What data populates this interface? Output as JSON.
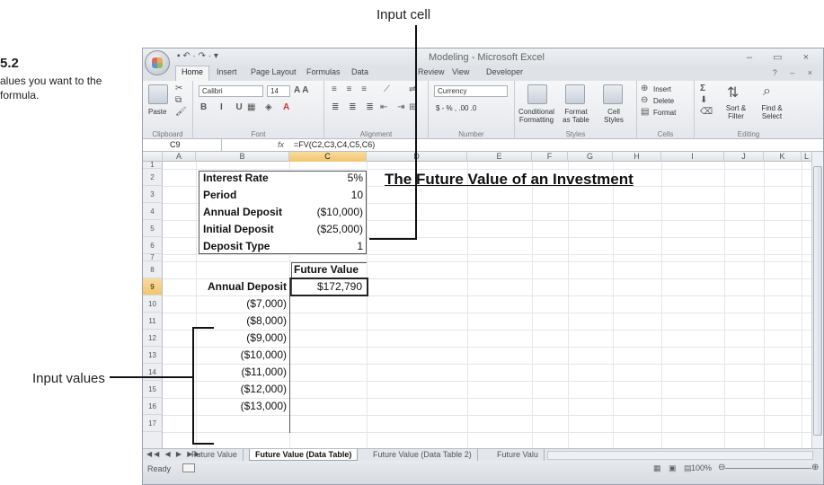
{
  "figure": {
    "number": "5.2",
    "caption": "alues you want to the formula.",
    "callout_input_cell": "Input cell",
    "callout_input_values": "Input values"
  },
  "window": {
    "title": "Modeling - Microsoft Excel",
    "qat": "▪ ↶ · ↷ · ▾",
    "controls": "– ▭ ×"
  },
  "ribbon": {
    "tabs": [
      "Home",
      "Insert",
      "Page Layout",
      "Formulas",
      "Data",
      "Review",
      "View",
      "Developer"
    ],
    "groups": {
      "clipboard": "Clipboard",
      "font": "Font",
      "alignment": "Alignment",
      "number": "Number",
      "styles": "Styles",
      "cells": "Cells",
      "editing": "Editing"
    },
    "paste": "Paste",
    "font_name": "Calibri",
    "font_size": "14",
    "number_format": "Currency",
    "number_row": "$ - % , .00 .0",
    "conditional": "Conditional\nFormatting",
    "format_table": "Format\nas Table",
    "cell_styles": "Cell\nStyles",
    "insert": "Insert",
    "delete": "Delete",
    "format": "Format",
    "sort": "Sort &\nFilter",
    "find": "Find &\nSelect"
  },
  "formula_bar": {
    "name_box": "C9",
    "fx": "fx",
    "formula": "=FV(C2,C3,C4,C5,C6)"
  },
  "columns": [
    "A",
    "B",
    "C",
    "D",
    "E",
    "F",
    "G",
    "H",
    "I",
    "J",
    "K",
    "L"
  ],
  "rows": [
    "1",
    "2",
    "3",
    "4",
    "5",
    "6",
    "7",
    "8",
    "9",
    "10",
    "11",
    "12",
    "13",
    "14",
    "15",
    "16",
    "17"
  ],
  "sheet": {
    "title": "The Future Value of an Investment",
    "inputs": [
      {
        "label": "Interest Rate",
        "value": "5%"
      },
      {
        "label": "Period",
        "value": "10"
      },
      {
        "label": "Annual Deposit",
        "value": "($10,000)"
      },
      {
        "label": "Initial Deposit",
        "value": "($25,000)"
      },
      {
        "label": "Deposit Type",
        "value": "1"
      }
    ],
    "table_header": "Future Value",
    "row_label": "Annual Deposit",
    "formula_result": "$172,790",
    "input_values": [
      "($7,000)",
      "($8,000)",
      "($9,000)",
      "($10,000)",
      "($11,000)",
      "($12,000)",
      "($13,000)"
    ]
  },
  "sheet_tabs": [
    "Future Value",
    "Future Value (Data Table)",
    "Future Value (Data Table 2)",
    "Future Valu"
  ],
  "active_sheet": "Future Value (Data Table)",
  "status": {
    "ready": "Ready",
    "zoom": "100%"
  }
}
